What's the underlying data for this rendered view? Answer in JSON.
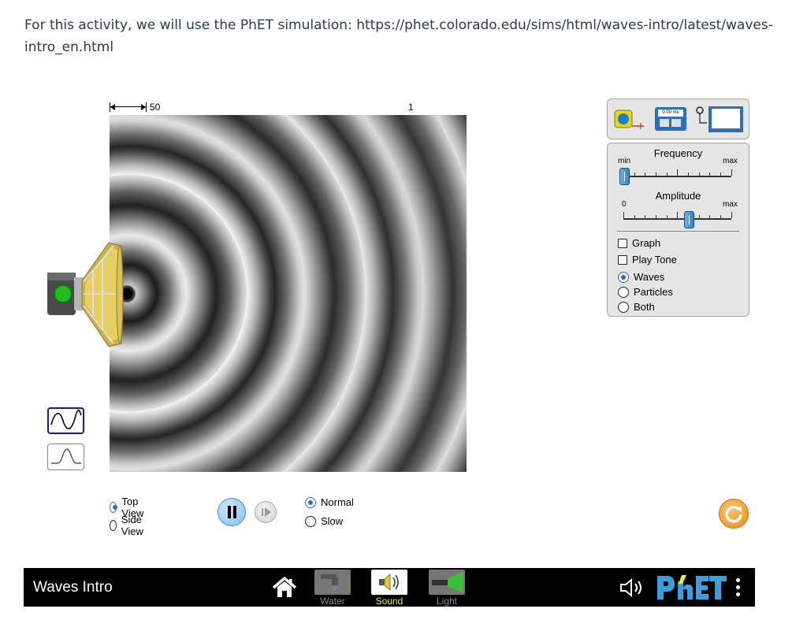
{
  "intro": "For this activity, we will use the PhET simulation: https://phet.colorado.edu/sims/html/waves-intro/latest/waves-intro_en.html",
  "sim": {
    "length_scale": "50 cm",
    "time_scale": "1 ms = 10",
    "time_scale_exp": "-3",
    "time_scale_unit": "s",
    "stopwatch_time": "0.00 ms",
    "frequency": {
      "title": "Frequency",
      "min_label": "min",
      "max_label": "max",
      "value": 0.0
    },
    "amplitude": {
      "title": "Amplitude",
      "min_label": "0",
      "max_label": "max",
      "value": 0.6
    },
    "checkboxes": [
      {
        "label": "Graph",
        "checked": false
      },
      {
        "label": "Play Tone",
        "checked": false
      }
    ],
    "view_modes": [
      {
        "label": "Waves",
        "selected": true
      },
      {
        "label": "Particles",
        "selected": false
      },
      {
        "label": "Both",
        "selected": false
      }
    ],
    "views": [
      {
        "label": "Top View",
        "selected": true
      },
      {
        "label": "Side View",
        "selected": false
      }
    ],
    "speeds": [
      {
        "label": "Normal",
        "selected": true
      },
      {
        "label": "Slow",
        "selected": false
      }
    ],
    "wave_type": "continuous"
  },
  "navbar": {
    "title": "Waves Intro",
    "screens": [
      {
        "label": "Water",
        "active": false
      },
      {
        "label": "Sound",
        "active": true
      },
      {
        "label": "Light",
        "active": false
      }
    ],
    "brand": "PhET",
    "colors": {
      "active_label": "#f2e916",
      "inactive_label": "#888888",
      "phet_blue": "#3b9ede",
      "phet_yellow": "#f2e916"
    }
  }
}
